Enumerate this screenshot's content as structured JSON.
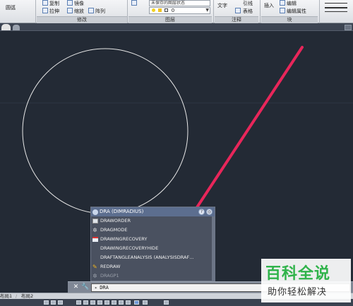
{
  "ribbon": {
    "draw_label": "圆弧",
    "modify_tools": [
      "复制",
      "拉伸",
      "镜像",
      "缩放",
      "阵列"
    ],
    "modify_caption": "修改",
    "layer_state_text": "未保存的图层状态",
    "layer_combo_value": "0",
    "layer_caption": "图层",
    "text_label": "文字",
    "leader_label": "引线",
    "table_label": "表格",
    "annotation_caption": "注释",
    "insert_label": "插入",
    "edit_label": "编辑",
    "edit_attr_label": "编辑属性",
    "block_caption": "块"
  },
  "autocomplete": {
    "header": "DRA (DIMRADIUS)",
    "items": [
      {
        "label": "DRAWORDER",
        "icon": "draworder-icon",
        "dim": false
      },
      {
        "label": "DRAGMODE",
        "icon": "gear-icon",
        "dim": false
      },
      {
        "label": "DRAWINGRECOVERY",
        "icon": "recovery-icon",
        "dim": false
      },
      {
        "label": "DRAWINGRECOVERYHIDE",
        "icon": "",
        "dim": false
      },
      {
        "label": "DRAFTANGLEANALYSIS (ANALYSISDRAF…",
        "icon": "",
        "dim": false
      },
      {
        "label": "REDRAW",
        "icon": "pencil-icon",
        "dim": false
      },
      {
        "label": "DRAGP1",
        "icon": "gear-icon",
        "dim": true
      }
    ]
  },
  "command": {
    "prompt": "▸",
    "value": "DRA"
  },
  "layout_tabs": [
    "布局1",
    "布局2"
  ],
  "watermark": {
    "title": "百科全说",
    "subtitle": "助你轻松解决"
  },
  "colors": {
    "canvas_bg": "#232a35",
    "arrow": "#e8265a",
    "circle": "#e8e8e8",
    "watermark_green": "#2fb34a"
  }
}
